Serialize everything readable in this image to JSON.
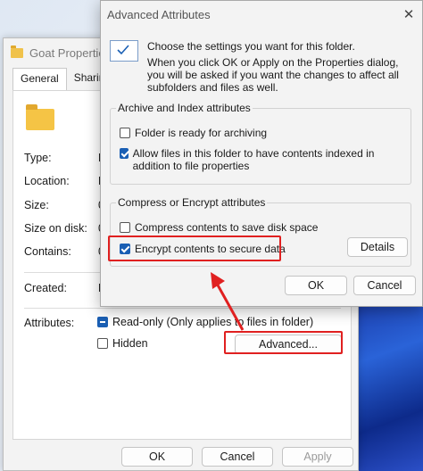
{
  "props_window": {
    "title": "Goat Properties",
    "tabs": [
      "General",
      "Sharing"
    ],
    "rows": [
      {
        "label": "Type:",
        "value": "F"
      },
      {
        "label": "Location:",
        "value": "F"
      },
      {
        "label": "Size:",
        "value": "0"
      },
      {
        "label": "Size on disk:",
        "value": "0"
      },
      {
        "label": "Contains:",
        "value": "0"
      },
      {
        "label": "Created:",
        "value": "M"
      }
    ],
    "attributes_label": "Attributes:",
    "readonly_label": "Read-only (Only applies to files in folder)",
    "hidden_label": "Hidden",
    "advanced_button": "Advanced...",
    "ok": "OK",
    "cancel": "Cancel",
    "apply": "Apply"
  },
  "adv_dialog": {
    "title": "Advanced Attributes",
    "close_glyph": "✕",
    "intro1": "Choose the settings you want for this folder.",
    "intro2": "When you click OK or Apply on the Properties dialog, you will be asked if you want the changes to affect all subfolders and files as well.",
    "archive_group": "Archive and Index attributes",
    "archive_cb": "Folder is ready for archiving",
    "index_cb": "Allow files in this folder to have contents indexed in addition to file properties",
    "compress_group": "Compress or Encrypt attributes",
    "compress_cb": "Compress contents to save disk space",
    "encrypt_cb": "Encrypt contents to secure data",
    "details_button": "Details",
    "ok": "OK",
    "cancel": "Cancel"
  },
  "colors": {
    "accent": "#1a5fb4",
    "annotation": "#e02020"
  }
}
